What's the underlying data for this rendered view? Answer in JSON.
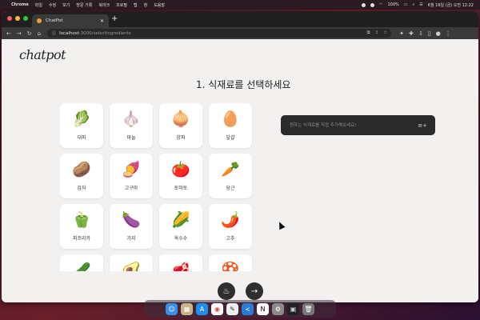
{
  "menubar": {
    "apple": "",
    "app_name": "Chrome",
    "items": [
      "파일",
      "수정",
      "보기",
      "방문 기록",
      "북마크",
      "프로필",
      "탭",
      "창",
      "도움말"
    ],
    "battery": "100%",
    "datetime": "6월 16일 (금) 오전 12:22"
  },
  "browser": {
    "tab_title": "ChatPot",
    "tab_close": "✕",
    "new_tab": "+",
    "url_host": "localhost",
    "url_path": ":3000/selectingredients"
  },
  "page": {
    "logo": "chatpot",
    "heading": "1. 식재료를 선택하세요",
    "input_placeholder": "원하는 식재료를 직접 추가해보세요!",
    "ingredients": [
      {
        "label": "대파",
        "icon": "🥬"
      },
      {
        "label": "마늘",
        "icon": "🧄"
      },
      {
        "label": "양파",
        "icon": "🧅"
      },
      {
        "label": "달걀",
        "icon": "🥚"
      },
      {
        "label": "감자",
        "icon": "🥔"
      },
      {
        "label": "고구마",
        "icon": "🍠"
      },
      {
        "label": "토마토",
        "icon": "🍅"
      },
      {
        "label": "당근",
        "icon": "🥕"
      },
      {
        "label": "파프리카",
        "icon": "🫑"
      },
      {
        "label": "가지",
        "icon": "🍆"
      },
      {
        "label": "옥수수",
        "icon": "🌽"
      },
      {
        "label": "고추",
        "icon": "🌶️"
      },
      {
        "label": "",
        "icon": "🥒"
      },
      {
        "label": "",
        "icon": "🥑"
      },
      {
        "label": "",
        "icon": "🥩"
      },
      {
        "label": "",
        "icon": "🍄"
      }
    ]
  },
  "colors": {
    "accent_dark": "#2f2f2f",
    "page_bg": "#f3f1ef"
  }
}
